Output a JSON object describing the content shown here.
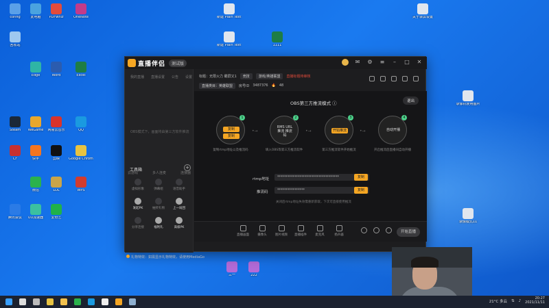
{
  "desktop_icons": [
    {
      "label": "config",
      "color": "#5aa0e8"
    },
    {
      "label": "此电脑",
      "color": "#4aa3df"
    },
    {
      "label": "PDFwhiz",
      "color": "#e34b3b"
    },
    {
      "label": "OneNote",
      "color": "#c23b8a"
    },
    {
      "label": "回收站",
      "color": "#9ec8f0"
    },
    {
      "label": "Edge",
      "color": "#2fb5a5"
    },
    {
      "label": "Word",
      "color": "#2b5caf"
    },
    {
      "label": "Excel",
      "color": "#1e7d45"
    },
    {
      "label": "Steam",
      "color": "#1b2838"
    },
    {
      "label": "WeGame",
      "color": "#e9a72c"
    },
    {
      "label": "网易云音乐",
      "color": "#d9332b"
    },
    {
      "label": "QQ",
      "color": "#1a9ae0"
    },
    {
      "label": "CF",
      "color": "#c73030"
    },
    {
      "label": "快手",
      "color": "#f47520"
    },
    {
      "label": "剪映",
      "color": "#111111"
    },
    {
      "label": "Google Chrome",
      "color": "#e8c341"
    },
    {
      "label": "微信",
      "color": "#2bb24c"
    },
    {
      "label": "LOL",
      "color": "#c9a44a"
    },
    {
      "label": "WPS",
      "color": "#d23b2e"
    },
    {
      "label": "腾讯会议",
      "color": "#2b7be6"
    },
    {
      "label": "UU加速器",
      "color": "#3bc0a0"
    },
    {
      "label": "爱奇艺",
      "color": "#20b24a"
    },
    {
      "label": "新建 Plain Text (5)",
      "color": "#e0e6ee"
    },
    {
      "label": "关于录屏设置",
      "color": "#e0e6ee"
    },
    {
      "label": "新建 Plain Text (4)",
      "color": "#e0e6ee"
    },
    {
      "label": "录像机使用图片",
      "color": "#e0e6ee"
    },
    {
      "label": "录像模式11",
      "color": "#e0e6ee"
    },
    {
      "label": "三一",
      "color": "#b46bd8"
    },
    {
      "label": "222",
      "color": "#b46bd8"
    },
    {
      "label": "1111",
      "color": "#1e7d45"
    }
  ],
  "app": {
    "name": "直播伴侣",
    "version": "测试版",
    "tabs": [
      "我的直播",
      "直播设置",
      "公告",
      "设置"
    ],
    "empty_hint": "OBS模式下，画面将由第三方软件推流",
    "room": {
      "title_label": "标题：无限火力 霸屏又1",
      "tag": "竞技",
      "tag2": "游戏/英雄联盟",
      "warning": "直播标题待审核",
      "category": "直播类目：英雄联盟",
      "room_id_label": "房号ID",
      "room_id": "3487376",
      "hot_label": "热度",
      "hot_value": "48"
    },
    "stage": {
      "title": "OBS第三方推流模式",
      "exit": "退出",
      "steps": [
        {
          "num": "1",
          "lines": [
            "复制",
            "复制"
          ],
          "caption": "复制rtmp地址以及推流码"
        },
        {
          "num": "2",
          "lines": [
            "RMS URL",
            "推流 推流码"
          ],
          "caption": "填入OBS等第三方推流软件"
        },
        {
          "num": "3",
          "lines": [
            "开始推流"
          ],
          "caption": "第三方推流软件开始推流"
        },
        {
          "num": "4",
          "lines": [
            "自动开播"
          ],
          "caption": "开启推流后直播间自动开播"
        }
      ],
      "rtmp_label": "rtmp地址",
      "rtmp_value": "************************************",
      "key_label": "推流码",
      "key_value": "****************",
      "copy_label": "复制",
      "help": "关闭后rtmp地址失效需重新获取，下次可直接使用推流"
    },
    "tools": {
      "title": "工具箱",
      "header": [
        "云游戏",
        "多人连麦",
        "连接器"
      ],
      "items": [
        {
          "label": "虚拟形象",
          "active": false
        },
        {
          "label": "弹幕组",
          "active": false
        },
        {
          "label": "语音助手",
          "active": false
        },
        {
          "label": "发起PK",
          "active": true
        },
        {
          "label": "抽奖礼物",
          "active": false
        },
        {
          "label": "上一局回",
          "active": true
        },
        {
          "label": "分享连接",
          "active": false
        },
        {
          "label": "福利礼",
          "active": true
        },
        {
          "label": "高级PK",
          "active": true
        }
      ]
    },
    "notice": "礼物特效：如需显示礼物特效，请使用MediaGo",
    "bottom_toolbar": [
      "直播画面",
      "摄像头",
      "图片视频",
      "直播插件",
      "麦克风",
      "扬声器"
    ],
    "start_button": "开始直播"
  },
  "taskbar": {
    "weather": "21°C 多云",
    "time": "20:27",
    "date": "2021/11/11",
    "icons": [
      {
        "name": "start-icon",
        "color": "#3aa0ff"
      },
      {
        "name": "search-icon",
        "color": "#dddddd"
      },
      {
        "name": "taskview-icon",
        "color": "#bbbbbb"
      },
      {
        "name": "chrome-taskbar-icon",
        "color": "#e8c341"
      },
      {
        "name": "folder-icon",
        "color": "#f2c14e"
      },
      {
        "name": "wechat-taskbar-icon",
        "color": "#2bb24c"
      },
      {
        "name": "qq-taskbar-icon",
        "color": "#1a9ae0"
      },
      {
        "name": "obs-taskbar-icon",
        "color": "#eeeeee"
      },
      {
        "name": "live-companion-taskbar-icon",
        "color": "#f5a623"
      },
      {
        "name": "steam-taskbar-icon",
        "color": "#8fb0d0"
      }
    ]
  }
}
